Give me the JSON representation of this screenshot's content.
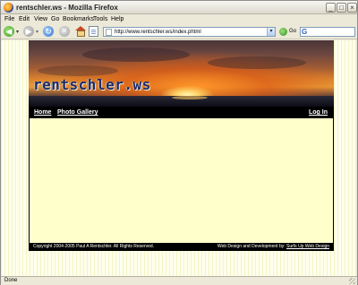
{
  "window": {
    "title": "rentschler.ws - Mozilla Firefox",
    "controls": {
      "minimize": "_",
      "maximize": "□",
      "close": "×"
    }
  },
  "menu": {
    "items": [
      "File",
      "Edit",
      "View",
      "Go",
      "Bookmarks",
      "Tools",
      "Help"
    ]
  },
  "toolbar": {
    "back_icon": "back-arrow-icon",
    "forward_icon": "forward-arrow-icon",
    "reload_icon": "reload-icon",
    "stop_icon": "stop-icon",
    "home_icon": "home-icon",
    "back_glyph": "◀",
    "forward_glyph": "▶",
    "reload_glyph": "↻",
    "stop_glyph": "✕",
    "dropdown_glyph": "▾",
    "url": "http://www.rentschler.ws/index.phtml",
    "go_label": "Go",
    "search_engine_glyph": "G"
  },
  "site": {
    "brand": "rentschler.ws",
    "nav": {
      "home": "Home",
      "gallery": "Photo Gallery",
      "login": "Log In"
    },
    "footer": {
      "copyright": "Copyright 2004-2005 Paul A Rentschler. All Rights Reserved.",
      "credit_prefix": "Web Design and Development by: ",
      "credit_link": "Surfs Up Web Design"
    }
  },
  "statusbar": {
    "status": "Done"
  },
  "colors": {
    "page_background": "#ffffee",
    "content_background": "#ffffcc",
    "site_frame": "#000000",
    "brand_text": "#1e2a6a"
  }
}
